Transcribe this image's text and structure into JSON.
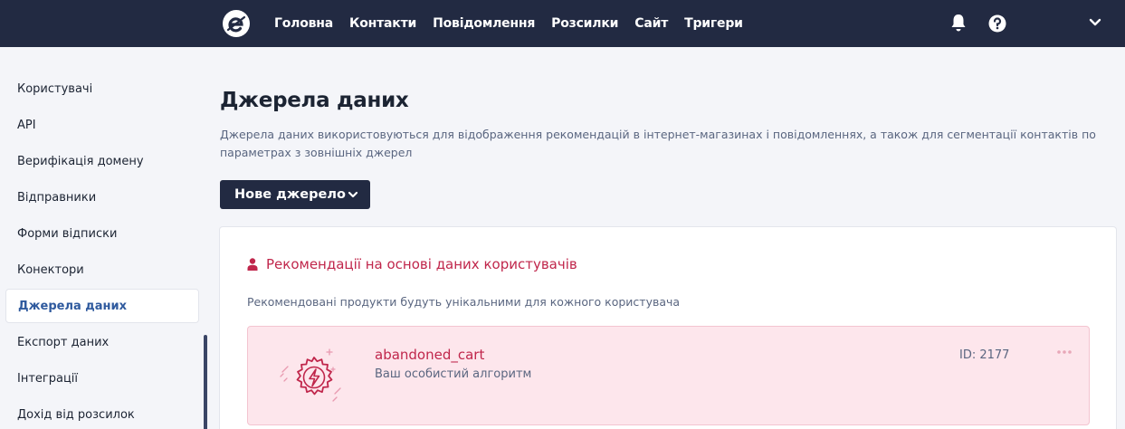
{
  "topbar": {
    "logo_icon": "sendpulse-logo-icon",
    "nav": [
      "Головна",
      "Контакти",
      "Повідомлення",
      "Розсилки",
      "Сайт",
      "Тригери"
    ],
    "icons": [
      "bell-icon",
      "help-icon",
      "chevron-down-icon"
    ],
    "background": "#222a42"
  },
  "sidebar": {
    "items": [
      {
        "label": "Користувачі",
        "active": false
      },
      {
        "label": "API",
        "active": false
      },
      {
        "label": "Верифікація домену",
        "active": false
      },
      {
        "label": "Відправники",
        "active": false
      },
      {
        "label": "Форми відписки",
        "active": false
      },
      {
        "label": "Конектори",
        "active": false
      },
      {
        "label": "Джерела даних",
        "active": true
      },
      {
        "label": "Експорт даних",
        "active": false
      },
      {
        "label": "Інтеграції",
        "active": false
      },
      {
        "label": "Дохід від розсилок",
        "active": false
      }
    ]
  },
  "page": {
    "title": "Джерела даних",
    "description": "Джерела даних використовуються для відображення рекомендацій в інтернет-магазинах і повідомленнях, а також для сегментації контактів по параметрах з зовнішніх джерел",
    "new_button": "Нове джерело"
  },
  "card": {
    "icon": "user-icon",
    "title": "Рекомендації на основі даних користувачів",
    "description": "Рекомендовані продукти будуть унікальними для кожного користувача",
    "items": [
      {
        "icon": "lightning-badge-icon",
        "name": "abandoned_cart",
        "subtitle": "Ваш особистий алгоритм",
        "id_label": "ID: 2177",
        "menu_icon": "more-horizontal-icon"
      }
    ]
  },
  "colors": {
    "accent": "#c0264b",
    "active_link": "#2f5a9e",
    "item_background": "#fde6ec"
  }
}
